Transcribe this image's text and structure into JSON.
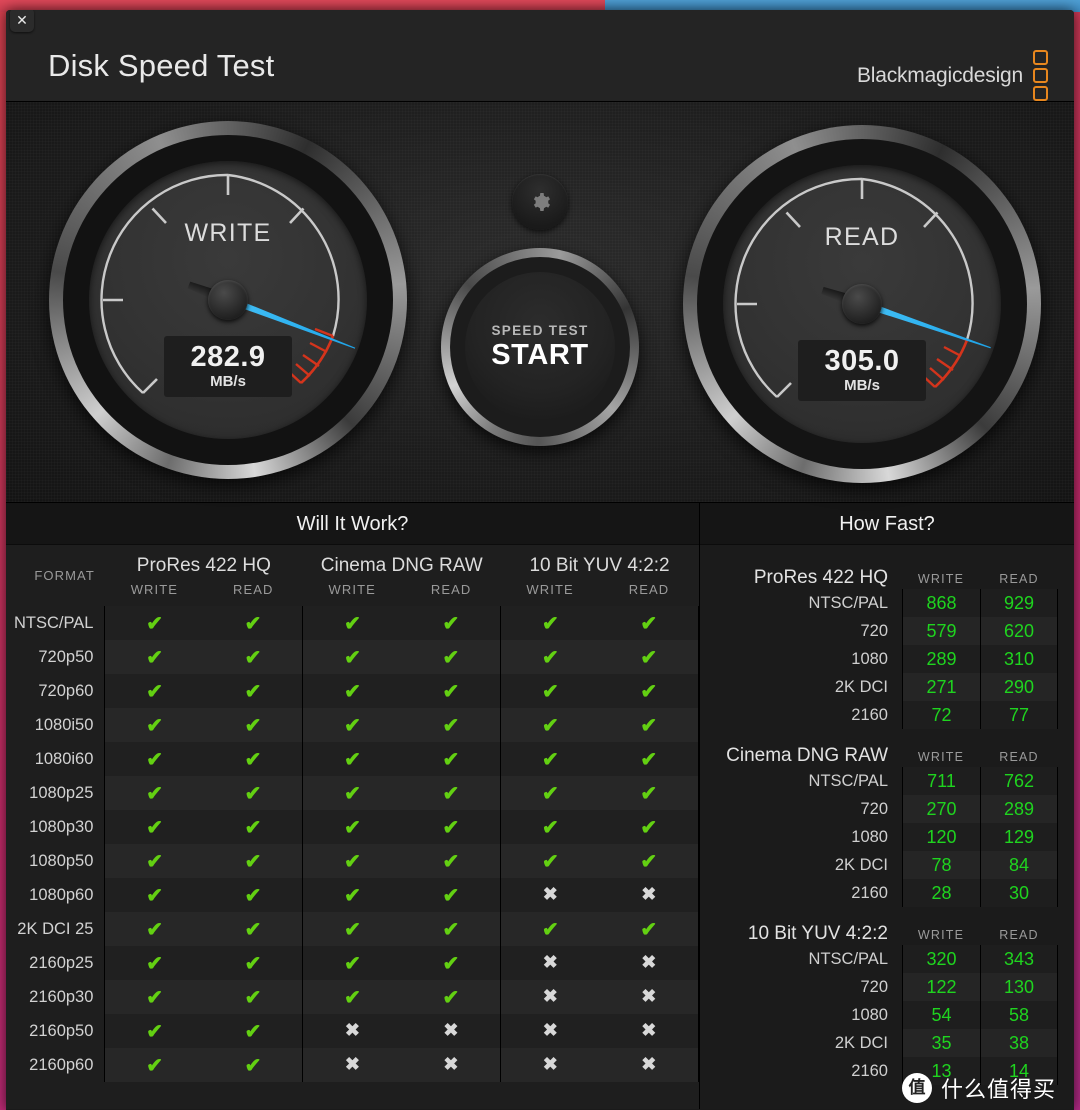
{
  "window": {
    "close_label": "✕",
    "app_title": "Disk Speed Test",
    "brand_text": "Blackmagicdesign"
  },
  "gauges": {
    "write": {
      "label": "WRITE",
      "value": "282.9",
      "unit": "MB/s",
      "needle_angle_deg": 201
    },
    "read": {
      "label": "READ",
      "value": "305.0",
      "unit": "MB/s",
      "needle_angle_deg": 199
    },
    "center": {
      "gear_icon": "gear-icon",
      "button_small_label": "SPEED TEST",
      "button_big_label": "START"
    }
  },
  "will_it_work": {
    "title": "Will It Work?",
    "format_header": "FORMAT",
    "codecs": [
      "ProRes 422 HQ",
      "Cinema DNG RAW",
      "10 Bit YUV 4:2:2"
    ],
    "sub_columns": [
      "WRITE",
      "READ"
    ],
    "ok_mark": "✔",
    "fail_mark": "✖",
    "rows": [
      {
        "format": "NTSC/PAL",
        "cells": [
          true,
          true,
          true,
          true,
          true,
          true
        ]
      },
      {
        "format": "720p50",
        "cells": [
          true,
          true,
          true,
          true,
          true,
          true
        ]
      },
      {
        "format": "720p60",
        "cells": [
          true,
          true,
          true,
          true,
          true,
          true
        ]
      },
      {
        "format": "1080i50",
        "cells": [
          true,
          true,
          true,
          true,
          true,
          true
        ]
      },
      {
        "format": "1080i60",
        "cells": [
          true,
          true,
          true,
          true,
          true,
          true
        ]
      },
      {
        "format": "1080p25",
        "cells": [
          true,
          true,
          true,
          true,
          true,
          true
        ]
      },
      {
        "format": "1080p30",
        "cells": [
          true,
          true,
          true,
          true,
          true,
          true
        ]
      },
      {
        "format": "1080p50",
        "cells": [
          true,
          true,
          true,
          true,
          true,
          true
        ]
      },
      {
        "format": "1080p60",
        "cells": [
          true,
          true,
          true,
          true,
          false,
          false
        ]
      },
      {
        "format": "2K DCI 25",
        "cells": [
          true,
          true,
          true,
          true,
          true,
          true
        ]
      },
      {
        "format": "2160p25",
        "cells": [
          true,
          true,
          true,
          true,
          false,
          false
        ]
      },
      {
        "format": "2160p30",
        "cells": [
          true,
          true,
          true,
          true,
          false,
          false
        ]
      },
      {
        "format": "2160p50",
        "cells": [
          true,
          true,
          false,
          false,
          false,
          false
        ]
      },
      {
        "format": "2160p60",
        "cells": [
          true,
          true,
          false,
          false,
          false,
          false
        ]
      }
    ]
  },
  "how_fast": {
    "title": "How Fast?",
    "col_write": "WRITE",
    "col_read": "READ",
    "groups": [
      {
        "name": "ProRes 422 HQ",
        "rows": [
          {
            "res": "NTSC/PAL",
            "write": "868",
            "read": "929"
          },
          {
            "res": "720",
            "write": "579",
            "read": "620"
          },
          {
            "res": "1080",
            "write": "289",
            "read": "310"
          },
          {
            "res": "2K DCI",
            "write": "271",
            "read": "290"
          },
          {
            "res": "2160",
            "write": "72",
            "read": "77"
          }
        ]
      },
      {
        "name": "Cinema DNG RAW",
        "rows": [
          {
            "res": "NTSC/PAL",
            "write": "711",
            "read": "762"
          },
          {
            "res": "720",
            "write": "270",
            "read": "289"
          },
          {
            "res": "1080",
            "write": "120",
            "read": "129"
          },
          {
            "res": "2K DCI",
            "write": "78",
            "read": "84"
          },
          {
            "res": "2160",
            "write": "28",
            "read": "30"
          }
        ]
      },
      {
        "name": "10 Bit YUV 4:2:2",
        "rows": [
          {
            "res": "NTSC/PAL",
            "write": "320",
            "read": "343"
          },
          {
            "res": "720",
            "write": "122",
            "read": "130"
          },
          {
            "res": "1080",
            "write": "54",
            "read": "58"
          },
          {
            "res": "2K DCI",
            "write": "35",
            "read": "38"
          },
          {
            "res": "2160",
            "write": "13",
            "read": "14"
          }
        ]
      }
    ]
  },
  "watermark": {
    "logo_char": "值",
    "text": "什么值得买"
  },
  "colors": {
    "accent_orange": "#e8871e",
    "needle_blue": "#34b6f2",
    "ok_green": "#63d012",
    "value_green": "#1fd41f",
    "red_zone": "#d4341c"
  }
}
